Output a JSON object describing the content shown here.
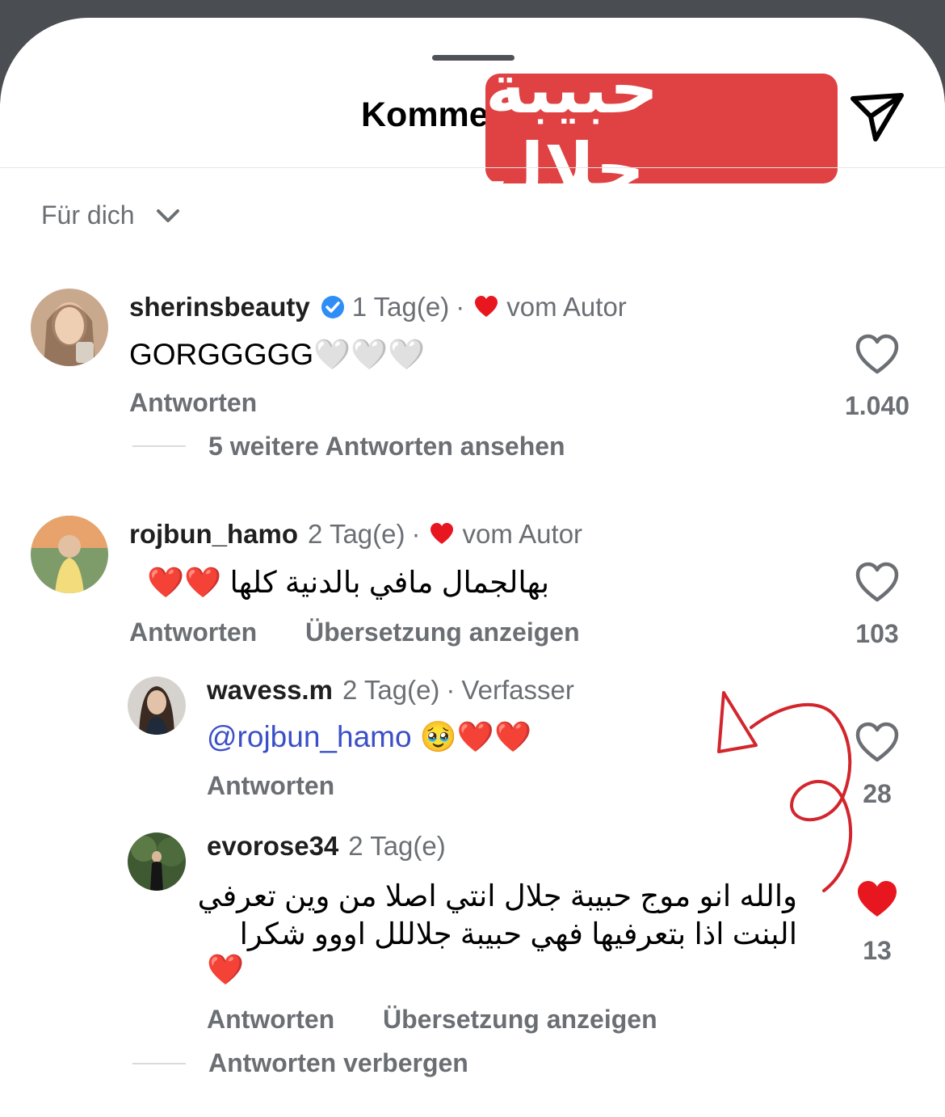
{
  "header": {
    "title": "Kommentare",
    "banner_text": "حبيبة جلال"
  },
  "sort": {
    "label": "Für dich"
  },
  "comments": [
    {
      "username": "sherinsbeauty",
      "verified": true,
      "time": "1 Tag(e)",
      "liked_label": "vom Autor",
      "text": "GORGGGGG",
      "text_emoji": "🤍🤍🤍",
      "reply": "Antworten",
      "view_replies": "5 weitere Antworten ansehen",
      "likes": "1.040"
    },
    {
      "username": "rojbun_hamo",
      "time": "2 Tag(e)",
      "liked_label": "vom Autor",
      "text": "بهالجمال مافي بالدنية كلها",
      "text_emoji": "❤️❤️",
      "reply": "Antworten",
      "translate": "Übersetzung anzeigen",
      "likes": "103"
    }
  ],
  "replies": [
    {
      "username": "wavess.m",
      "time": "2 Tag(e)",
      "badge": "Verfasser",
      "mention": "@rojbun_hamo",
      "text_emoji": "🥹❤️❤️",
      "reply": "Antworten",
      "likes": "28"
    },
    {
      "username": "evorose34",
      "time": "2 Tag(e)",
      "text_line1": "والله انو موج حبيبة جلال انتي اصلا من وين تعرفي",
      "text_line2": "البنت اذا بتعرفيها فهي حبيبة جلاللل اووو شكرا",
      "text_emoji": "❤️",
      "reply": "Antworten",
      "translate": "Übersetzung anzeigen",
      "hide_replies": "Antworten verbergen",
      "likes": "13",
      "liked": true
    }
  ],
  "colors": {
    "accent_red": "#e04142",
    "heart_red": "#e8171f",
    "mention_blue": "#3b4fc8",
    "muted_gray": "#6b6f74"
  }
}
